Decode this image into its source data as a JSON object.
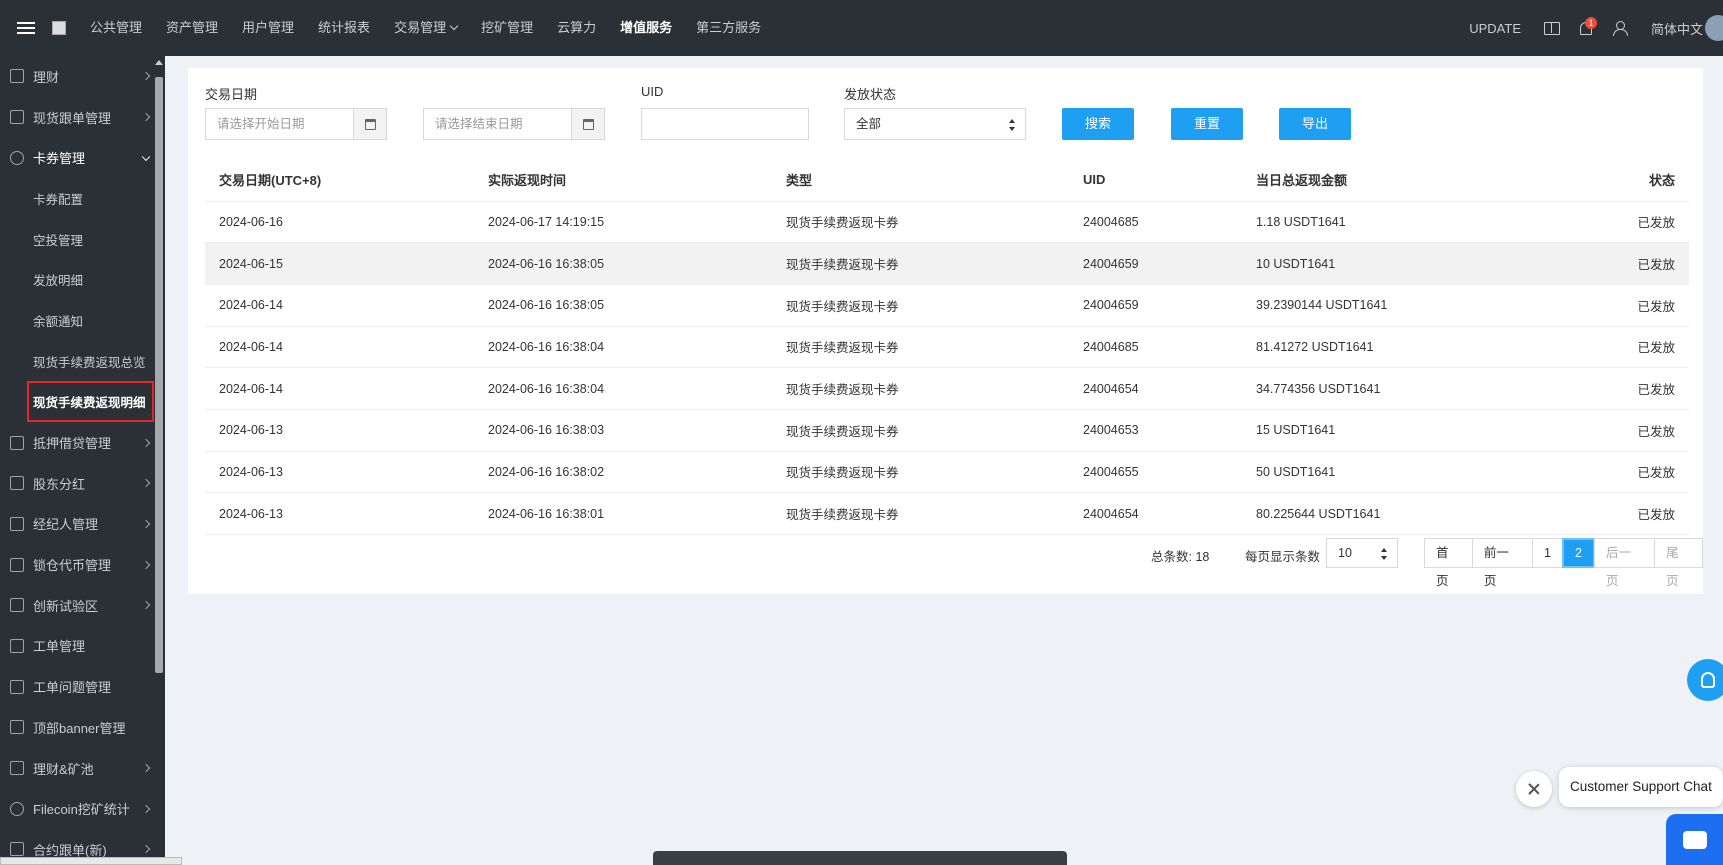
{
  "topnav": {
    "items": [
      {
        "label": "公共管理"
      },
      {
        "label": "资产管理"
      },
      {
        "label": "用户管理"
      },
      {
        "label": "统计报表"
      },
      {
        "label": "交易管理"
      },
      {
        "label": "挖矿管理"
      },
      {
        "label": "云算力"
      },
      {
        "label": "增值服务"
      },
      {
        "label": "第三方服务"
      }
    ],
    "active": "增值服务",
    "update_label": "UPDATE",
    "notification_count": "1",
    "language": "简体中文"
  },
  "sidebar": {
    "items": [
      {
        "label": "理财"
      },
      {
        "label": "现货跟单管理"
      },
      {
        "label": "卡券管理"
      },
      {
        "label": "抵押借贷管理"
      },
      {
        "label": "股东分红"
      },
      {
        "label": "经纪人管理"
      },
      {
        "label": "锁仓代币管理"
      },
      {
        "label": "创新试验区"
      },
      {
        "label": "工单管理"
      },
      {
        "label": "工单问题管理"
      },
      {
        "label": "顶部banner管理"
      },
      {
        "label": "理财&矿池"
      },
      {
        "label": "Filecoin挖矿统计"
      },
      {
        "label": "合约跟单(新)"
      }
    ],
    "sub_items": [
      {
        "label": "卡券配置"
      },
      {
        "label": "空投管理"
      },
      {
        "label": "发放明细"
      },
      {
        "label": "余额通知"
      },
      {
        "label": "现货手续费返现总览"
      },
      {
        "label": "现货手续费返现明细"
      }
    ]
  },
  "filters": {
    "date_label": "交易日期",
    "start_placeholder": "请选择开始日期",
    "end_placeholder": "请选择结束日期",
    "uid_label": "UID",
    "uid_value": "",
    "status_label": "发放状态",
    "status_value": "全部",
    "search_button": "搜索",
    "reset_button": "重置",
    "export_button": "导出"
  },
  "table": {
    "columns": [
      "交易日期(UTC+8)",
      "实际返现时间",
      "类型",
      "UID",
      "当日总返现金额",
      "状态"
    ],
    "rows": [
      [
        "2024-06-16",
        "2024-06-17 14:19:15",
        "现货手续费返现卡券",
        "24004685",
        "1.18 USDT1641",
        "已发放"
      ],
      [
        "2024-06-15",
        "2024-06-16 16:38:05",
        "现货手续费返现卡券",
        "24004659",
        "10 USDT1641",
        "已发放"
      ],
      [
        "2024-06-14",
        "2024-06-16 16:38:05",
        "现货手续费返现卡券",
        "24004659",
        "39.2390144 USDT1641",
        "已发放"
      ],
      [
        "2024-06-14",
        "2024-06-16 16:38:04",
        "现货手续费返现卡券",
        "24004685",
        "81.41272 USDT1641",
        "已发放"
      ],
      [
        "2024-06-14",
        "2024-06-16 16:38:04",
        "现货手续费返现卡券",
        "24004654",
        "34.774356 USDT1641",
        "已发放"
      ],
      [
        "2024-06-13",
        "2024-06-16 16:38:03",
        "现货手续费返现卡券",
        "24004653",
        "15 USDT1641",
        "已发放"
      ],
      [
        "2024-06-13",
        "2024-06-16 16:38:02",
        "现货手续费返现卡券",
        "24004655",
        "50 USDT1641",
        "已发放"
      ],
      [
        "2024-06-13",
        "2024-06-16 16:38:01",
        "现货手续费返现卡券",
        "24004654",
        "80.225644 USDT1641",
        "已发放"
      ]
    ]
  },
  "pager": {
    "total_label": "总条数: 18",
    "per_page_label": "每页显示条数",
    "per_page_value": "10",
    "first": "首页",
    "prev": "前一页",
    "pages": [
      "1",
      "2"
    ],
    "current_page": "2",
    "next": "后一页",
    "last": "尾页"
  },
  "chat": {
    "bubble_text": "Customer Support Chat"
  },
  "colors": {
    "nav_bg": "#2b2f36",
    "accent": "#1e9ff2",
    "highlight_border": "#e8242b"
  }
}
